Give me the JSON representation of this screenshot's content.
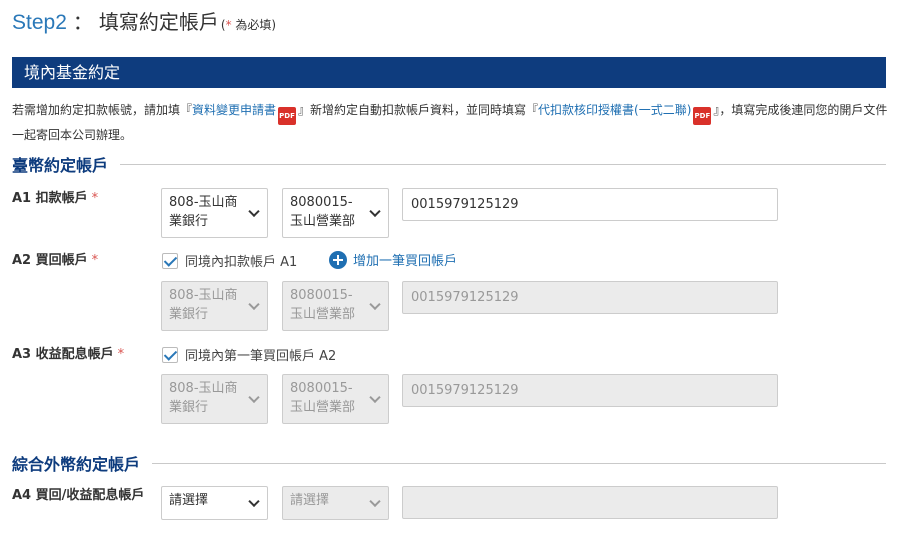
{
  "header": {
    "step": "Step2",
    "colon": "：",
    "title": "填寫約定帳戶",
    "note_open": "(",
    "note_star": "*",
    "note_text": " 為必填)"
  },
  "section": {
    "title": "境內基金約定"
  },
  "description": {
    "part1": "若需增加約定扣款帳號，請加填『",
    "link1": "資料變更申請書",
    "part2": "』新增約定自動扣款帳戶資料，並同時填寫『",
    "link2": "代扣款核印授權書(一式二聯)",
    "part3": "』，填寫完成後連同您的開戶文件一起寄回本公司辦理。",
    "pdf_badge": "PDF"
  },
  "twd": {
    "heading": "臺幣約定帳戶",
    "a1": {
      "label": "A1 扣款帳戶",
      "required": "*",
      "bank": "808-玉山商業銀行",
      "branch": "8080015-玉山營業部",
      "account": "0015979125129"
    },
    "a2": {
      "label": "A2 買回帳戶",
      "required": "*",
      "checkbox_label": "同境內扣款帳戶 A1",
      "add_link": "增加一筆買回帳戶",
      "bank": "808-玉山商業銀行",
      "branch": "8080015-玉山營業部",
      "account": "0015979125129"
    },
    "a3": {
      "label": "A3 收益配息帳戶",
      "required": "*",
      "checkbox_label": "同境內第一筆買回帳戶 A2",
      "bank": "808-玉山商業銀行",
      "branch": "8080015-玉山營業部",
      "account": "0015979125129"
    }
  },
  "foreign": {
    "heading": "綜合外幣約定帳戶",
    "a4": {
      "label": "A4 買回/收益配息帳戶",
      "bank_placeholder": "請選擇",
      "branch_placeholder": "請選擇",
      "account": ""
    }
  },
  "colors": {
    "primary_navy": "#0e3c7e",
    "link_blue": "#1f6fb2",
    "step_blue": "#2a78b8",
    "required_red": "#d9534f",
    "disabled_bg": "#ebebeb"
  }
}
